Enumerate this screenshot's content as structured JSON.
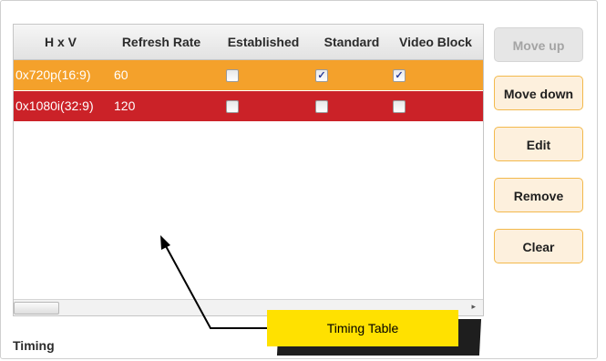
{
  "table": {
    "columns": [
      "H x V",
      "Refresh Rate",
      "Established",
      "Standard",
      "Video Block"
    ],
    "rows": [
      {
        "hxv": "0x720p(16:9)",
        "refresh": "60",
        "established": false,
        "standard": true,
        "video_block": true,
        "color": "#f4a12b"
      },
      {
        "hxv": "0x1080i(32:9)",
        "refresh": "120",
        "established": false,
        "standard": false,
        "video_block": false,
        "color": "#cb2228"
      }
    ],
    "checkmark": "✓"
  },
  "buttons": {
    "move_up": "Move up",
    "move_down": "Move down",
    "edit": "Edit",
    "remove": "Remove",
    "clear": "Clear"
  },
  "section_label": "Timing",
  "callout": {
    "text": "Timing Table",
    "color": "#ffe100"
  },
  "scrollbar": {
    "arrow": "▸"
  }
}
